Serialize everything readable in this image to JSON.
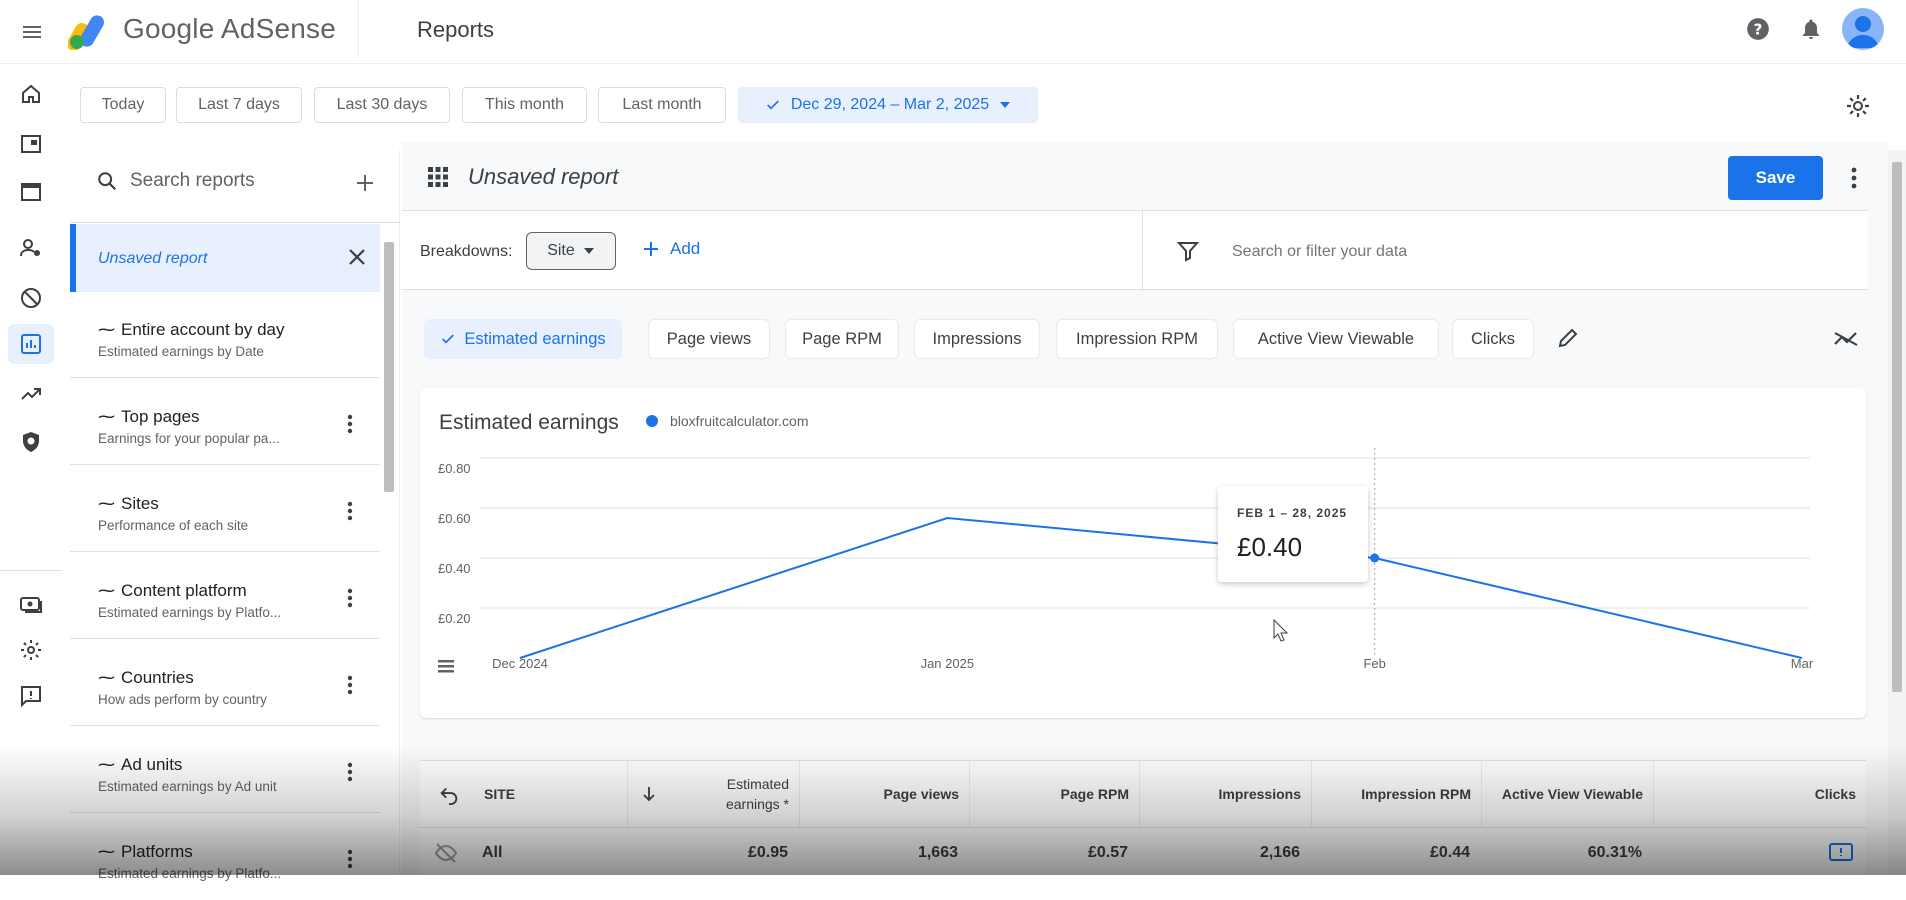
{
  "app": {
    "product_name": "Google AdSense",
    "section_title": "Reports"
  },
  "date_filters": {
    "today": "Today",
    "last7": "Last 7 days",
    "last30": "Last 30 days",
    "this_month": "This month",
    "last_month": "Last month",
    "selected_range": "Dec 29, 2024 – Mar 2, 2025"
  },
  "reports_panel": {
    "search_placeholder": "Search reports",
    "unsaved_label": "Unsaved report",
    "items": [
      {
        "title": "Entire account by day",
        "subtitle": "Estimated earnings by Date"
      },
      {
        "title": "Top pages",
        "subtitle": "Earnings for your popular pa..."
      },
      {
        "title": "Sites",
        "subtitle": "Performance of each site"
      },
      {
        "title": "Content platform",
        "subtitle": "Estimated earnings by Platfo..."
      },
      {
        "title": "Countries",
        "subtitle": "How ads perform by country"
      },
      {
        "title": "Ad units",
        "subtitle": "Estimated earnings by Ad unit"
      },
      {
        "title": "Platforms",
        "subtitle": "Estimated earnings by Platfo..."
      }
    ]
  },
  "report": {
    "title": "Unsaved report",
    "save_label": "Save",
    "breakdowns_label": "Breakdowns:",
    "breakdown_chip": "Site",
    "add_label": "Add",
    "filter_placeholder": "Search or filter your data"
  },
  "metrics": {
    "estimated_earnings": "Estimated earnings",
    "page_views": "Page views",
    "page_rpm": "Page RPM",
    "impressions": "Impressions",
    "impression_rpm": "Impression RPM",
    "active_view_viewable": "Active View Viewable",
    "clicks": "Clicks"
  },
  "chart_data": {
    "type": "line",
    "title": "Estimated earnings",
    "x": [
      "Dec 2024",
      "Jan 2025",
      "Feb",
      "Mar"
    ],
    "series": [
      {
        "name": "bloxfruitcalculator.com",
        "values": [
          0.0,
          0.56,
          0.4,
          0.0
        ],
        "color": "#1a73e8"
      }
    ],
    "ylim": [
      0,
      0.8
    ],
    "yticks": [
      "£0.80",
      "£0.60",
      "£0.40",
      "£0.20"
    ],
    "grid": true,
    "legend": "top-left",
    "tooltip": {
      "date": "FEB 1 – 28, 2025",
      "value": "£0.40"
    }
  },
  "table": {
    "headers": {
      "site": "SITE",
      "estimated_earnings": "Estimated earnings *",
      "page_views": "Page views",
      "page_rpm": "Page RPM",
      "impressions": "Impressions",
      "impression_rpm": "Impression RPM",
      "active_view_viewable": "Active View Viewable",
      "clicks": "Clicks"
    },
    "row_all": {
      "site": "All",
      "estimated_earnings": "£0.95",
      "page_views": "1,663",
      "page_rpm": "£0.57",
      "impressions": "2,166",
      "impression_rpm": "£0.44",
      "active_view_viewable": "60.31%"
    }
  },
  "colors": {
    "accent": "#1a73e8",
    "accent_light": "#e8f0fe"
  }
}
